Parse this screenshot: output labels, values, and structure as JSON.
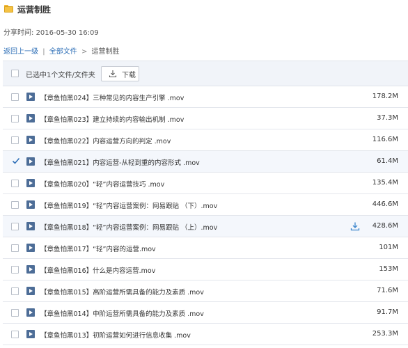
{
  "header": {
    "title": "运营制胜"
  },
  "share": {
    "label": "分享时间:",
    "time": "2016-05-30 16:09"
  },
  "breadcrumb": {
    "back": "返回上一级",
    "separator": "|",
    "all_files": "全部文件",
    "arrow": ">",
    "current": "运营制胜"
  },
  "toolbar": {
    "selected_text": "已选中1个文件/文件夹",
    "download_label": "下载",
    "download_icon": "download-icon"
  },
  "files": [
    {
      "name": "【章鱼怕黑024】三种常见的内容生产引擎 .mov",
      "size": "178.2M",
      "checked": false
    },
    {
      "name": "【章鱼怕黑023】建立持续的内容输出机制 .mov",
      "size": "37.3M",
      "checked": false
    },
    {
      "name": "【章鱼怕黑022】内容运营方向的判定 .mov",
      "size": "116.6M",
      "checked": false
    },
    {
      "name": "【章鱼怕黑021】内容运营-从轻到重的内容形式 .mov",
      "size": "61.4M",
      "checked": true
    },
    {
      "name": "【章鱼怕黑020】“轻”内容运营技巧 .mov",
      "size": "135.4M",
      "checked": false
    },
    {
      "name": "【章鱼怕黑019】“轻”内容运营案例：网易跟贴 （下）.mov",
      "size": "446.6M",
      "checked": false
    },
    {
      "name": "【章鱼怕黑018】“轻”内容运营案例：网易跟贴 （上）.mov",
      "size": "428.6M",
      "checked": false,
      "hover": true
    },
    {
      "name": "【章鱼怕黑017】“轻”内容的运营.mov",
      "size": "101M",
      "checked": false
    },
    {
      "name": "【章鱼怕黑016】什么是内容运营.mov",
      "size": "153M",
      "checked": false
    },
    {
      "name": "【章鱼怕黑015】高阶运营所需具备的能力及素质 .mov",
      "size": "71.6M",
      "checked": false
    },
    {
      "name": "【章鱼怕黑014】中阶运营所需具备的能力及素质 .mov",
      "size": "91.7M",
      "checked": false
    },
    {
      "name": "【章鱼怕黑013】初阶运营如何进行信息收集 .mov",
      "size": "253.3M",
      "checked": false
    }
  ],
  "colors": {
    "link": "#2e6fb7",
    "header_bg": "#f1f4f9",
    "video_icon": "#4d6d97",
    "download_blue": "#3d86cc"
  }
}
